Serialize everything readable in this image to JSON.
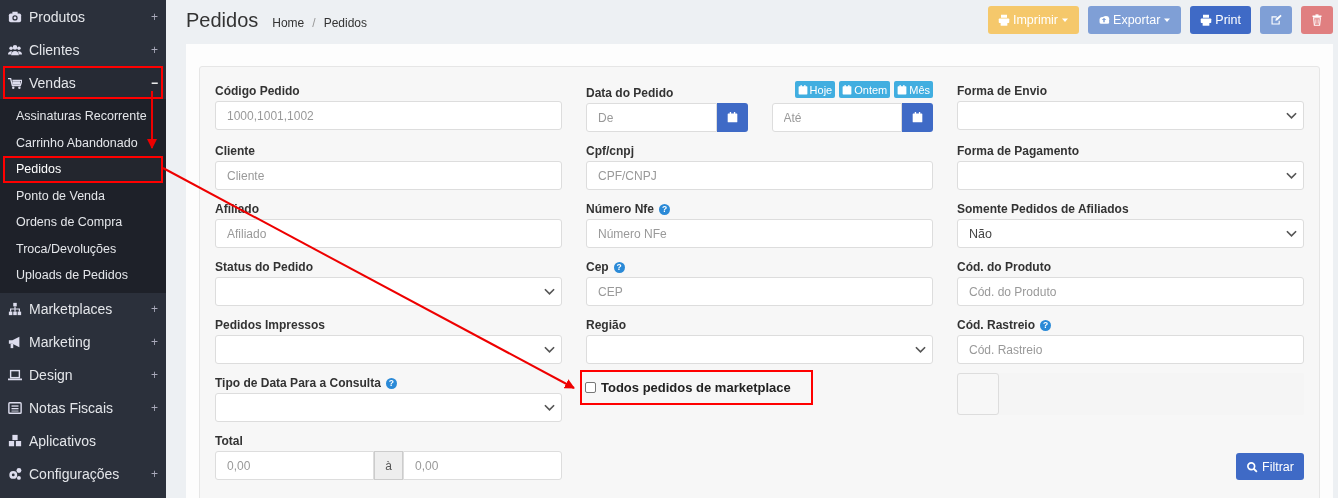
{
  "sidebar": {
    "items": [
      {
        "label": "Produtos",
        "toggle": "+",
        "expanded": false,
        "highlighted": false
      },
      {
        "label": "Clientes",
        "toggle": "+",
        "expanded": false,
        "highlighted": false
      },
      {
        "label": "Vendas",
        "toggle": "−",
        "expanded": true,
        "highlighted": true,
        "children": [
          {
            "label": "Assinaturas Recorrente",
            "selected": false,
            "highlighted": false
          },
          {
            "label": "Carrinho Abandonado",
            "selected": false,
            "highlighted": false
          },
          {
            "label": "Pedidos",
            "selected": true,
            "highlighted": true
          },
          {
            "label": "Ponto de Venda",
            "selected": false,
            "highlighted": false
          },
          {
            "label": "Ordens de Compra",
            "selected": false,
            "highlighted": false
          },
          {
            "label": "Troca/Devoluções",
            "selected": false,
            "highlighted": false
          },
          {
            "label": "Uploads de Pedidos",
            "selected": false,
            "highlighted": false
          }
        ]
      },
      {
        "label": "Marketplaces",
        "toggle": "+",
        "expanded": false,
        "highlighted": false
      },
      {
        "label": "Marketing",
        "toggle": "+",
        "expanded": false,
        "highlighted": false
      },
      {
        "label": "Design",
        "toggle": "+",
        "expanded": false,
        "highlighted": false
      },
      {
        "label": "Notas Fiscais",
        "toggle": "+",
        "expanded": false,
        "highlighted": false
      },
      {
        "label": "Aplicativos",
        "expanded": false,
        "highlighted": false
      },
      {
        "label": "Configurações",
        "toggle": "+",
        "expanded": false,
        "highlighted": false
      }
    ]
  },
  "header": {
    "title": "Pedidos",
    "breadcrumb": [
      "Home",
      "Pedidos"
    ],
    "separator": "/",
    "buttons": [
      {
        "label": "Imprimir",
        "dropdown": true
      },
      {
        "label": "Exportar",
        "dropdown": true
      },
      {
        "label": "Print",
        "dropdown": false
      },
      {
        "dropdown": false
      },
      {
        "dropdown": false
      }
    ]
  },
  "filters": [
    {
      "kind": "text",
      "label": "Código Pedido",
      "placeholder": "1000,1001,1002"
    },
    {
      "kind": "date-range",
      "label": "Data do Pedido",
      "quick": [
        "Hoje",
        "Ontem",
        "Mês"
      ],
      "from_placeholder": "De",
      "to_placeholder": "Até"
    },
    {
      "kind": "select",
      "label": "Forma de Envio"
    },
    {
      "kind": "text",
      "label": "Cliente",
      "placeholder": "Cliente"
    },
    {
      "kind": "text",
      "label": "Cpf/cnpj",
      "placeholder": "CPF/CNPJ"
    },
    {
      "kind": "select",
      "label": "Forma de Pagamento"
    },
    {
      "kind": "text",
      "label": "Afiliado",
      "placeholder": "Afiliado"
    },
    {
      "kind": "text",
      "label": "Número Nfe",
      "help": "?",
      "placeholder": "Número NFe"
    },
    {
      "kind": "select",
      "label": "Somente Pedidos de Afiliados",
      "value": "Não"
    },
    {
      "kind": "select",
      "label": "Status do Pedido"
    },
    {
      "kind": "text",
      "label": "Cep",
      "help": "?",
      "placeholder": "CEP"
    },
    {
      "kind": "text",
      "label": "Cód. do Produto",
      "placeholder": "Cód. do Produto"
    },
    {
      "kind": "select",
      "label": "Pedidos Impressos"
    },
    {
      "kind": "select",
      "label": "Região"
    },
    {
      "kind": "text",
      "label": "Cód. Rastreio",
      "help": "?",
      "placeholder": "Cód. Rastreio"
    },
    {
      "kind": "select",
      "label": "Tipo de Data Para a Consulta",
      "help": "?"
    },
    {
      "kind": "checkbox",
      "label": "Todos pedidos de marketplace",
      "checked": false,
      "highlighted": true
    },
    {
      "kind": "summary"
    },
    {
      "kind": "range",
      "label": "Total",
      "from_placeholder": "0,00",
      "separator": "à",
      "to_placeholder": "0,00"
    },
    {
      "kind": "button",
      "label": "Filtrar"
    }
  ]
}
